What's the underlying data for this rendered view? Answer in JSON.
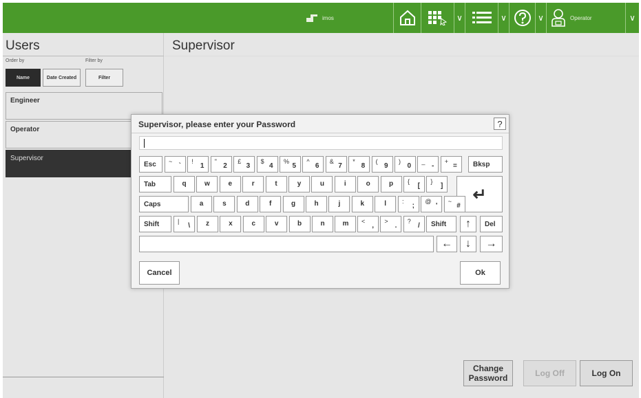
{
  "header": {
    "brand": "imos",
    "operator_label": "Operator",
    "chevron": "∨",
    "colors": {
      "bar": "#4a9a2a",
      "accent": "#ffffff"
    }
  },
  "users_panel": {
    "title": "Users",
    "order_by_label": "Order by",
    "filter_by_label": "Filter by",
    "sort_name": "Name",
    "sort_date": "Date Created",
    "filter_button": "Filter",
    "items": [
      {
        "label": "Engineer"
      },
      {
        "label": "Operator"
      },
      {
        "label": "Supervisor"
      }
    ],
    "selected": "Supervisor"
  },
  "detail": {
    "title": "Supervisor",
    "change_password": "Change Password",
    "log_off": "Log Off",
    "log_on": "Log On"
  },
  "dialog": {
    "title": "Supervisor, please enter your Password",
    "help": "?",
    "password_value": "",
    "cancel": "Cancel",
    "ok": "Ok",
    "keys": {
      "esc": "Esc",
      "tab": "Tab",
      "caps": "Caps",
      "shift": "Shift",
      "bksp": "Bksp",
      "del": "Del",
      "row1": [
        {
          "up": "~",
          "dn": "`"
        },
        {
          "up": "!",
          "dn": "1"
        },
        {
          "up": "\"",
          "dn": "2"
        },
        {
          "up": "£",
          "dn": "3"
        },
        {
          "up": "$",
          "dn": "4"
        },
        {
          "up": "%",
          "dn": "5"
        },
        {
          "up": "^",
          "dn": "6"
        },
        {
          "up": "&",
          "dn": "7"
        },
        {
          "up": "*",
          "dn": "8"
        },
        {
          "up": "(",
          "dn": "9"
        },
        {
          "up": ")",
          "dn": "0"
        },
        {
          "up": "_",
          "dn": "-"
        },
        {
          "up": "+",
          "dn": "="
        }
      ],
      "row2": [
        "q",
        "w",
        "e",
        "r",
        "t",
        "y",
        "u",
        "i",
        "o",
        "p"
      ],
      "row2_sym": [
        {
          "up": "{",
          "dn": "["
        },
        {
          "up": "}",
          "dn": "]"
        }
      ],
      "row3": [
        "a",
        "s",
        "d",
        "f",
        "g",
        "h",
        "j",
        "k",
        "l"
      ],
      "row3_sym": [
        {
          "up": ":",
          "dn": ";"
        },
        {
          "up": "@",
          "dn": "'"
        },
        {
          "up": "~",
          "dn": "#"
        }
      ],
      "row4_sym_left": {
        "up": "|",
        "dn": "\\"
      },
      "row4": [
        "z",
        "x",
        "c",
        "v",
        "b",
        "n",
        "m"
      ],
      "row4_sym": [
        {
          "up": "<",
          "dn": ","
        },
        {
          "up": ">",
          "dn": "."
        },
        {
          "up": "?",
          "dn": "/"
        }
      ],
      "arrows": {
        "up": "↑",
        "down": "↓",
        "left": "←",
        "right": "→",
        "enter": "↵"
      }
    }
  }
}
